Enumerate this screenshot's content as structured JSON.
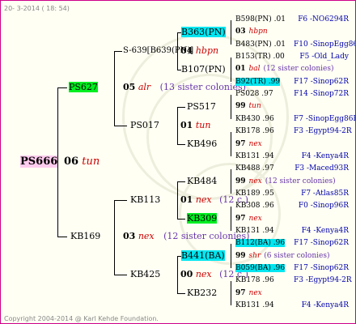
{
  "header": {
    "date": "20-  3-2014  ( 18: 54)"
  },
  "footer": {
    "copyright": "Copyright 2004-2014 @ Karl Kehde Foundation."
  },
  "root": {
    "id": "PS666",
    "year": "06",
    "mark": "tun"
  },
  "gen1": {
    "top": {
      "id": "PS627"
    },
    "bottom": {
      "id": "KB169"
    }
  },
  "gen2": {
    "top": {
      "num": "05",
      "mark": "alr",
      "note": "(13 sister colonies)"
    },
    "p017": {
      "id": "PS017"
    },
    "kb113": {
      "id": "KB113"
    },
    "bottom": {
      "num": "03",
      "mark": "nex",
      "note": "(12 sister colonies)"
    },
    "kb425": {
      "id": "KB425"
    }
  },
  "gen3": {
    "s639": {
      "label": "S-639[B639(PN)]",
      "num": "04",
      "mark": "hbpn"
    },
    "ps517": {
      "id": "PS517"
    },
    "p01": {
      "num": "01",
      "mark": "tun"
    },
    "kb496": {
      "id": "KB496"
    },
    "kb484": {
      "id": "KB484"
    },
    "k01": {
      "num": "01",
      "mark": "nex",
      "note": "(12 c.)"
    },
    "kb309": {
      "id": "KB309"
    },
    "b441": {
      "id": "B441(BA)"
    },
    "k00": {
      "num": "00",
      "mark": "nex",
      "note": "(12 c.)"
    },
    "kb232": {
      "id": "KB232"
    }
  },
  "gen4": {
    "b363": {
      "id": "B363(PN)"
    },
    "b107": {
      "id": "B107(PN)"
    }
  },
  "gen5": [
    {
      "line": "B598(PN) .01",
      "loc": "F6 -NO6294R"
    },
    {
      "num": "03",
      "mark": "hbpn",
      "note": ""
    },
    {
      "line": "B483(PN) .01",
      "loc": "F10 -SinopEgg86R"
    },
    {
      "line": "B153(TR) .00",
      "loc": "F5 -Old_Lady"
    },
    {
      "num": "01",
      "mark": "bal",
      "note": "(12 sister colonies)"
    },
    {
      "line": "B92(TR) .99",
      "loc": "F17 -Sinop62R"
    },
    {
      "line": "PS028 .97",
      "loc": "F14 -Sinop72R"
    },
    {
      "num": "99",
      "mark": "tun",
      "note": ""
    },
    {
      "line": "KB430 .96",
      "loc": "F7 -SinopEgg86R"
    },
    {
      "line": "KB178 .96",
      "loc": "F3 -Egypt94-2R"
    },
    {
      "num": "97",
      "mark": "nex",
      "note": ""
    },
    {
      "line": "KB131 .94",
      "loc": "F4 -Kenya4R"
    },
    {
      "line": "KB488 .97",
      "loc": "F3 -Maced93R"
    },
    {
      "num": "99",
      "mark": "nex",
      "note": "(12 sister colonies)"
    },
    {
      "line": "KB189 .95",
      "loc": "F7 -Atlas85R"
    },
    {
      "line": "KB308 .96",
      "loc": "F0 -Sinop96R"
    },
    {
      "num": "97",
      "mark": "nex",
      "note": ""
    },
    {
      "line": "KB131 .94",
      "loc": "F4 -Kenya4R"
    },
    {
      "line": "B112(BA) .96",
      "loc": "F17 -Sinop62R"
    },
    {
      "num": "99",
      "mark": "shr",
      "note": "(6 sister colonies)"
    },
    {
      "line": "B059(BA) .96",
      "loc": "F17 -Sinop62R"
    },
    {
      "line": "KB178 .96",
      "loc": "F3 -Egypt94-2R"
    },
    {
      "num": "97",
      "mark": "nex",
      "note": ""
    },
    {
      "line": "KB131 .94",
      "loc": "F4 -Kenya4R"
    }
  ]
}
